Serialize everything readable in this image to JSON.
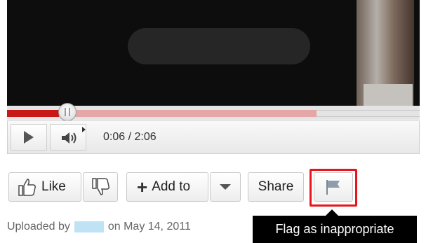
{
  "player": {
    "time_display": "0:06 / 2:06",
    "played_fraction": 0.125,
    "loaded_fraction": 0.75
  },
  "actions": {
    "like_label": "Like",
    "add_to_label": "Add to",
    "share_label": "Share"
  },
  "uploader": {
    "prefix": "Uploaded by",
    "date_text": "on May 14, 2011"
  },
  "tooltip": {
    "text": "Flag as inappropriate"
  },
  "colors": {
    "highlight": "#e8151b",
    "progress_played": "#c81818"
  },
  "icons": {
    "play": "play-icon",
    "volume": "volume-icon",
    "like": "thumbs-up-icon",
    "dislike": "thumbs-down-icon",
    "add": "plus-icon",
    "dropdown": "chevron-down-icon",
    "flag": "flag-icon"
  }
}
